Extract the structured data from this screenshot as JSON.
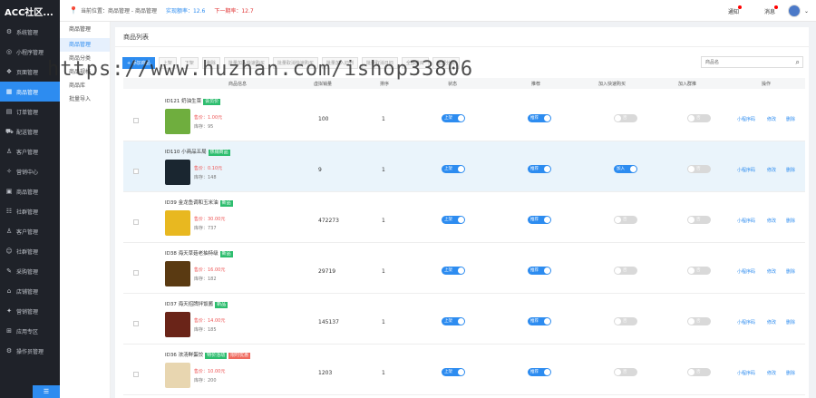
{
  "app": {
    "brand": "ACC社区..."
  },
  "sidebar": {
    "items": [
      {
        "label": "系统管理",
        "icon": "gear-icon",
        "glyph": "⚙"
      },
      {
        "label": "小程序管理",
        "icon": "miniapp-icon",
        "glyph": "◎"
      },
      {
        "label": "页面管理",
        "icon": "page-icon",
        "glyph": "❖"
      },
      {
        "label": "商品管理",
        "icon": "goods-icon",
        "glyph": "▦"
      },
      {
        "label": "订单管理",
        "icon": "order-icon",
        "glyph": "▤"
      },
      {
        "label": "配送管理",
        "icon": "truck-icon",
        "glyph": "⛟"
      },
      {
        "label": "客户管理",
        "icon": "user-icon",
        "glyph": "♙"
      },
      {
        "label": "营销中心",
        "icon": "marketing-icon",
        "glyph": "✧"
      },
      {
        "label": "商品管理",
        "icon": "box-icon",
        "glyph": "▣"
      },
      {
        "label": "社群管理",
        "icon": "group-icon",
        "glyph": "☷"
      },
      {
        "label": "客户管理",
        "icon": "user2-icon",
        "glyph": "♙"
      },
      {
        "label": "社群管理",
        "icon": "community-icon",
        "glyph": "☺"
      },
      {
        "label": "采购管理",
        "icon": "purchase-icon",
        "glyph": "✎"
      },
      {
        "label": "店铺管理",
        "icon": "shop-icon",
        "glyph": "⌂"
      },
      {
        "label": "营销管理",
        "icon": "promo-icon",
        "glyph": "✦"
      },
      {
        "label": "应用专区",
        "icon": "apps-icon",
        "glyph": "⊞"
      },
      {
        "label": "操作员管理",
        "icon": "operator-icon",
        "glyph": "⚙"
      }
    ],
    "active_index": 3,
    "bottom_label": "☰"
  },
  "topbar": {
    "location": "当前位置：商品管理 - 商品管理",
    "stat1": "实现额率：12.6",
    "stat2": "下一期率：12.7",
    "notice": "通知",
    "message": "消息"
  },
  "subnav": {
    "title": "商品管理",
    "items": [
      "商品管理",
      "商品分类",
      "商品规格",
      "商品库",
      "批量导入"
    ],
    "active_index": 0
  },
  "main": {
    "title": "商品列表"
  },
  "toolbar": {
    "buttons": [
      "+ 添加商品",
      "上架",
      "下架",
      "删除",
      "批量加入快速购买",
      "批量取消快速购买",
      "批量加入旧列",
      "批量取消日旧",
      "全部类目",
      "全部分类"
    ]
  },
  "search": {
    "placeholder": "商品名"
  },
  "table": {
    "headers": [
      "商品信息",
      "虚拟销量",
      "排序",
      "状态",
      "推荐",
      "加入快速购买",
      "加入群推",
      "操作"
    ],
    "rows": [
      {
        "name": "ID121 奶油生菜",
        "tags": [
          {
            "text": "会员价",
            "color": "#2dbd6e"
          }
        ],
        "price": "售价：1.00元",
        "stock": "库存：95",
        "sales": "100",
        "sort": "1",
        "status": "上架",
        "rec": "推荐",
        "quick": "否",
        "group": "否",
        "img": "lettuce-image",
        "imgbg": "#6fae3e",
        "hl": false
      },
      {
        "name": "ID110 小商品五局",
        "tags": [
          {
            "text": "热销商品",
            "color": "#2dbd6e"
          }
        ],
        "price": "售价：0.10元",
        "stock": "库存：148",
        "sales": "9",
        "sort": "1",
        "status": "上架",
        "rec": "推荐",
        "quick": "加入",
        "group": "否",
        "img": "product-image",
        "imgbg": "#1a2630",
        "hl": true
      },
      {
        "name": "ID39 金龙鱼调和玉米油",
        "tags": [
          {
            "text": "新品",
            "color": "#2dbd6e"
          }
        ],
        "price": "售价：30.00元",
        "stock": "库存：737",
        "sales": "472273",
        "sort": "1",
        "status": "上架",
        "rec": "推荐",
        "quick": "否",
        "group": "否",
        "img": "oil-image",
        "imgbg": "#e8b820",
        "hl": false
      },
      {
        "name": "ID38 海天草菇老抽特级",
        "tags": [
          {
            "text": "新品",
            "color": "#2dbd6e"
          }
        ],
        "price": "售价：16.00元",
        "stock": "库存：182",
        "sales": "29719",
        "sort": "1",
        "status": "上架",
        "rec": "推荐",
        "quick": "否",
        "group": "否",
        "img": "sauce-image",
        "imgbg": "#5a3a12",
        "hl": false
      },
      {
        "name": "ID37 海天招牌拌饭酱",
        "tags": [
          {
            "text": "新品",
            "color": "#2dbd6e"
          }
        ],
        "price": "售价：14.00元",
        "stock": "库存：185",
        "sales": "145137",
        "sort": "1",
        "status": "上架",
        "rec": "推荐",
        "quick": "否",
        "group": "否",
        "img": "jar-image",
        "imgbg": "#6a2418",
        "hl": false
      },
      {
        "name": "ID36 浓汤鲜蛋饺",
        "tags": [
          {
            "text": "特价活动",
            "color": "#2dbd6e"
          },
          {
            "text": "限时优惠",
            "color": "#ef6a5e"
          }
        ],
        "price": "售价：10.00元",
        "stock": "库存：200",
        "sales": "1203",
        "sort": "1",
        "status": "上架",
        "rec": "推荐",
        "quick": "否",
        "group": "否",
        "img": "dumpling-image",
        "imgbg": "#e8d6b0",
        "hl": false
      }
    ],
    "ops": [
      "小程序码",
      "修改",
      "删除"
    ]
  },
  "watermark": "https://www.huzhan.com/ishop33806"
}
